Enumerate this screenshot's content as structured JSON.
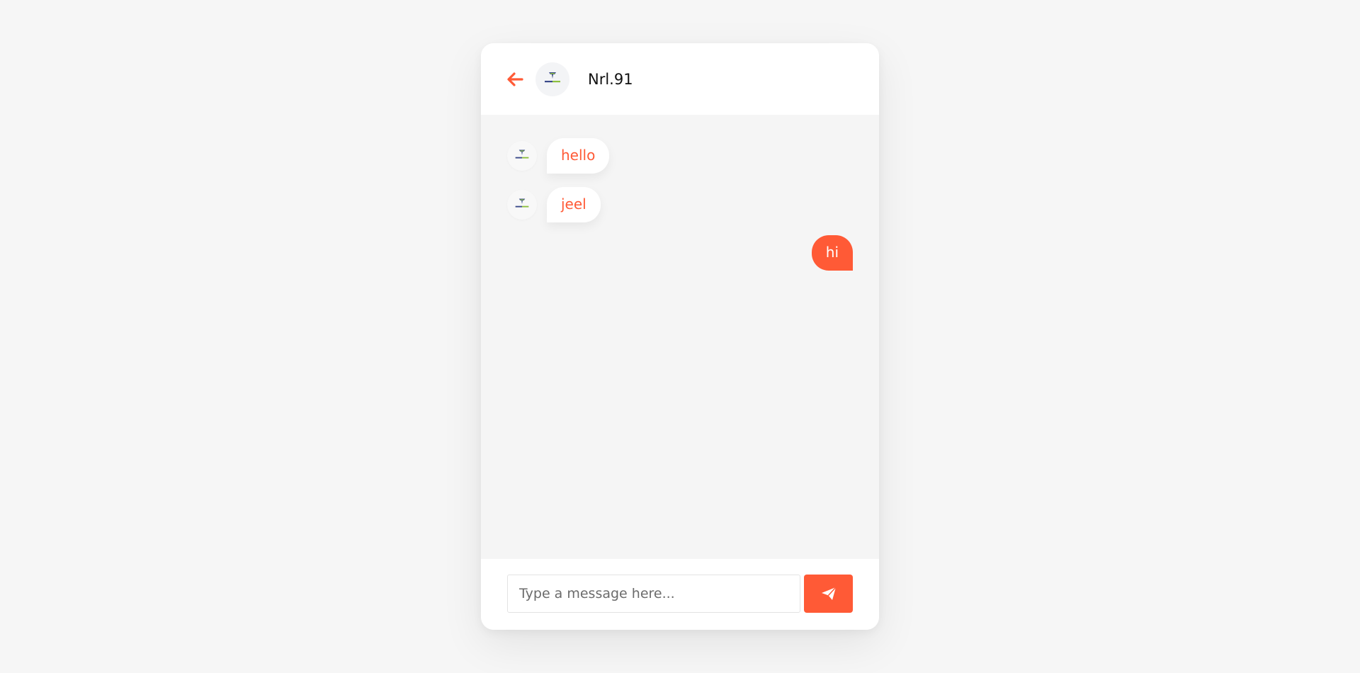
{
  "header": {
    "title": "Nrl.91",
    "back_icon": "arrow-left-icon",
    "avatar_icon": "technoinsight-logo"
  },
  "messages": [
    {
      "direction": "incoming",
      "text": "hello",
      "avatar_icon": "technoinsight-logo"
    },
    {
      "direction": "incoming",
      "text": "jeel",
      "avatar_icon": "technoinsight-logo"
    },
    {
      "direction": "outgoing",
      "text": "hi"
    }
  ],
  "composer": {
    "placeholder": "Type a message here...",
    "send_icon": "paper-plane-icon"
  },
  "colors": {
    "accent": "#ff5a36",
    "page_background": "#f6f6f6",
    "chat_background": "#f5f5f5",
    "card_background": "#ffffff"
  }
}
